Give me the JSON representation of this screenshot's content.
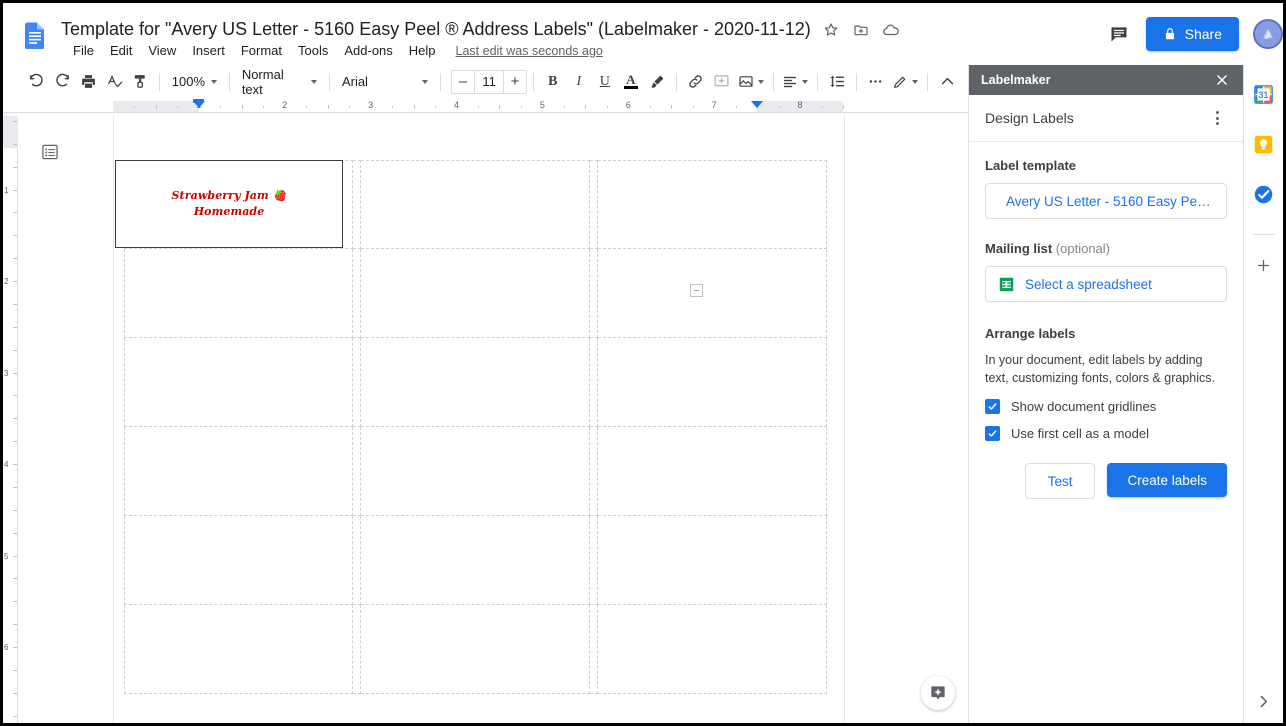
{
  "app": {
    "logo_icon": "google-docs-icon",
    "doc_title": "Template for \"Avery US Letter - 5160 Easy Peel ® Address Labels\" (Labelmaker - 2020-11-12)",
    "title_icons": [
      "star-icon",
      "move-to-folder-icon",
      "cloud-saved-icon"
    ],
    "menus": [
      "File",
      "Edit",
      "View",
      "Insert",
      "Format",
      "Tools",
      "Add-ons",
      "Help"
    ],
    "last_edit": "Last edit was seconds ago",
    "comment_icon": "comment-history-icon",
    "share_label": "Share",
    "share_icon": "lock-icon",
    "avatar_icon": "user-avatar"
  },
  "toolbar": {
    "undo_icon": "undo-icon",
    "redo_icon": "redo-icon",
    "print_icon": "print-icon",
    "spellcheck_icon": "spellcheck-icon",
    "paintformat_icon": "paint-format-icon",
    "zoom_value": "100%",
    "style_value": "Normal text",
    "font_value": "Arial",
    "font_size": "11",
    "decrease_label": "–",
    "increase_label": "+",
    "bold_label": "B",
    "italic_label": "I",
    "underline_label": "U",
    "text_color_label": "A",
    "highlight_icon": "highlight-icon",
    "link_icon": "insert-link-icon",
    "comment_icon": "add-comment-icon",
    "image_icon": "insert-image-icon",
    "align_icon": "align-left-icon",
    "linespacing_icon": "line-spacing-icon",
    "more_icon": "more-options-icon",
    "editmode_icon": "edit-mode-pencil-icon",
    "collapse_icon": "hide-menus-chevron-icon"
  },
  "ruler": {
    "h_numbers": [
      "1",
      "2",
      "3",
      "4",
      "5",
      "6",
      "7",
      "8"
    ],
    "left_indent_marker": "left-indent-marker",
    "right_indent_marker": "right-indent-marker",
    "v_numbers": [
      "1",
      "2",
      "3",
      "4",
      "5",
      "6"
    ]
  },
  "document": {
    "outline_icon": "document-outline-icon",
    "label_line1": "Strawberry Jam 🍓",
    "label_line2": "Homemade",
    "label_text_color": "#cc0000",
    "grid_columns": 3,
    "grid_rows": 6,
    "table_handle_icon": "table-resize-handle-icon",
    "explore_icon": "explore-icon"
  },
  "panel": {
    "title": "Labelmaker",
    "close_icon": "close-icon",
    "subtitle": "Design Labels",
    "kebab_icon": "more-vert-icon",
    "label_template_title": "Label template",
    "label_template_value": "Avery US Letter - 5160 Easy Peel ...",
    "mailing_list_title": "Mailing list",
    "mailing_list_optional": "(optional)",
    "mailing_list_value": "Select a spreadsheet",
    "sheets_icon": "google-sheets-icon",
    "arrange_title": "Arrange labels",
    "arrange_help": "In your document, edit labels by adding text, customizing fonts, colors & graphics.",
    "checkbox_gridlines": "Show document gridlines",
    "checkbox_firstcell": "Use first cell as a model",
    "checkbox_icon": "checkmark-icon",
    "test_label": "Test",
    "create_label": "Create labels",
    "accent_color": "#1a73e8"
  },
  "rail": {
    "icons": [
      "google-calendar-icon",
      "google-keep-icon",
      "google-tasks-icon"
    ],
    "add_icon": "add-on-plus-icon",
    "expand_icon": "chevron-right-icon"
  }
}
